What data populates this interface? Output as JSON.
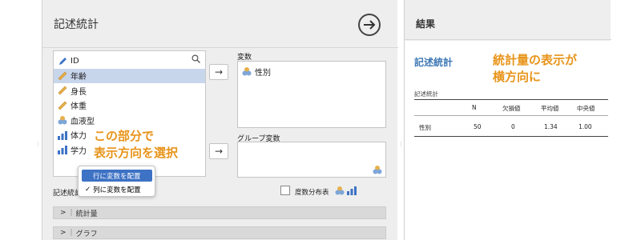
{
  "analysis": {
    "title": "記述統計",
    "run_icon": "arrow-right-circle-icon"
  },
  "variables": [
    {
      "label": "ID",
      "icon": "nominal-text-icon"
    },
    {
      "label": "年齢",
      "icon": "continuous-ruler-icon"
    },
    {
      "label": "身長",
      "icon": "continuous-ruler-icon"
    },
    {
      "label": "体重",
      "icon": "continuous-ruler-icon"
    },
    {
      "label": "血液型",
      "icon": "nominal-circles-icon"
    },
    {
      "label": "体力",
      "icon": "ordinal-bars-icon"
    },
    {
      "label": "学力",
      "icon": "ordinal-bars-icon"
    }
  ],
  "selected_variable_index": 1,
  "variables_box": {
    "label": "変数",
    "items": [
      {
        "label": "性別",
        "icon": "nominal-circles-icon"
      }
    ]
  },
  "split_box": {
    "label": "グループ変数"
  },
  "transfer_arrow": "→",
  "annotation_left": [
    "この部分で",
    "表示方向を選択"
  ],
  "orientation": {
    "label": "記述統計",
    "options": [
      "行に変数を配置",
      "列に変数を配置"
    ],
    "checkmark": "✓",
    "checked_index": 1
  },
  "freq_checkbox": {
    "label": "度数分布表",
    "checked": false
  },
  "sections": [
    {
      "label": "統計量",
      "chevron": ">"
    },
    {
      "label": "グラフ",
      "chevron": ">"
    }
  ],
  "results": {
    "header": "結果",
    "title": "記述統計",
    "subtitle": "記述統計",
    "annotation": [
      "統計量の表示が",
      "横方向に"
    ],
    "columns": [
      "",
      "N",
      "欠損値",
      "平均値",
      "中央値"
    ],
    "rows": [
      [
        "性別",
        "50",
        "0",
        "1.34",
        "1.00"
      ]
    ]
  },
  "colors": {
    "accent_blue": "#3d72c4",
    "annotation_orange": "#e8941a",
    "results_title_blue": "#3f79b6",
    "selected_row": "#c8d6ec"
  }
}
